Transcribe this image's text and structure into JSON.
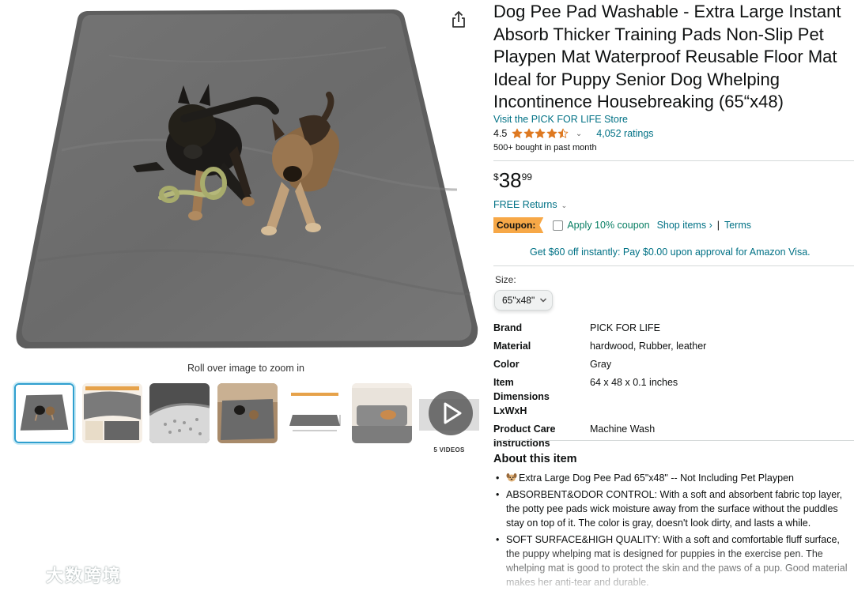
{
  "product": {
    "title": "Dog Pee Pad Washable - Extra Large Instant Absorb Thicker Training Pads Non-Slip Pet Playpen Mat Waterproof Reusable Floor Mat Ideal for Puppy Senior Dog Whelping Incontinence Housebreaking (65“x48)",
    "store_link": "Visit the PICK FOR LIFE Store",
    "rating_value": "4.5",
    "rating_stars": 4.5,
    "ratings_count": "4,052 ratings",
    "bought": "500+ bought in past month"
  },
  "price": {
    "symbol": "$",
    "whole": "38",
    "fraction": "99"
  },
  "returns": {
    "label": "FREE Returns"
  },
  "coupon": {
    "badge": "Coupon:",
    "apply_text": "Apply 10% coupon",
    "shop_items": "Shop items ›",
    "separator": "|",
    "terms": "Terms",
    "checked": false
  },
  "visa_offer": "Get $60 off instantly: Pay $0.00 upon approval for Amazon Visa.",
  "size": {
    "label": "Size:",
    "selected": "65\"x48\""
  },
  "specs": [
    {
      "key": "Brand",
      "value": "PICK FOR LIFE"
    },
    {
      "key": "Material",
      "value": "hardwood, Rubber, leather"
    },
    {
      "key": "Color",
      "value": "Gray"
    },
    {
      "key": "Item Dimensions LxWxH",
      "value": "64 x 48 x 0.1 inches"
    },
    {
      "key": "Product Care Instructions",
      "value": "Machine Wash"
    }
  ],
  "about": {
    "title": "About this item",
    "bullets": [
      "Extra Large Dog Pee Pad 65\"x48\" -- Not Including Pet Playpen",
      "ABSORBENT&ODOR CONTROL: With a soft and absorbent fabric top layer, the potty pee pads wick moisture away from the surface without the puddles stay on top of it. The color is gray, doesn't look dirty, and lasts a while.",
      "SOFT SURFACE&HIGH QUALITY: With a soft and comfortable fluff surface, the puppy whelping mat is designed for puppies in the exercise pen. The whelping mat is good to protect the skin and the paws of a pup. Good material makes her anti-tear and durable."
    ]
  },
  "media": {
    "zoom_hint": "Roll over image to zoom in",
    "videos_label": "5 VIDEOS"
  },
  "watermark": {
    "text": "大数跨境"
  },
  "colors": {
    "link": "#007185",
    "coupon_badge": "#f7a847",
    "coupon_text": "#067d62",
    "star": "#de7921",
    "mat_gray": "#6e6e6e"
  },
  "icons": {
    "share": "share-icon",
    "play": "play-icon",
    "star": "star-icon",
    "chevron": "chevron-down-icon"
  }
}
